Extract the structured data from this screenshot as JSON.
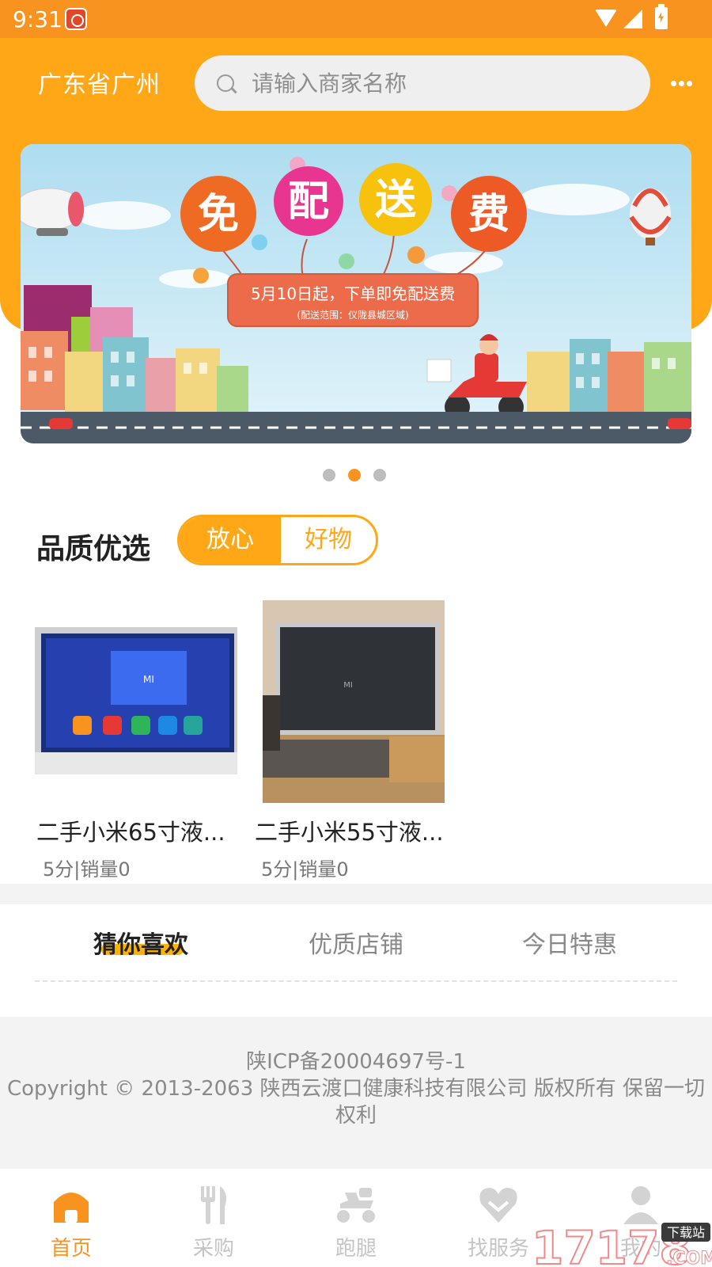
{
  "status_bar": {
    "time": "9:31"
  },
  "header": {
    "location": "广东省广州",
    "search_placeholder": "请输入商家名称"
  },
  "banner": {
    "balloon_chars": [
      "免",
      "配",
      "送",
      "费"
    ],
    "promo_main": "5月10日起，下单即免配送费",
    "promo_sub": "(配送范围：仪陇县城区域)",
    "active_dot": 1,
    "dot_count": 3
  },
  "quality": {
    "title": "品质优选",
    "toggle_left": "放心",
    "toggle_right": "好物",
    "products": [
      {
        "name": "二手小米65寸液...",
        "meta": "5分|销量0"
      },
      {
        "name": "二手小米55寸液...",
        "meta": "5分|销量0"
      }
    ]
  },
  "tabs": [
    {
      "label": "猜你喜欢",
      "active": true
    },
    {
      "label": "优质店铺",
      "active": false
    },
    {
      "label": "今日特惠",
      "active": false
    }
  ],
  "footer": {
    "icp": "陕ICP备20004697号-1",
    "copyright": "Copyright © 2013-2063 陕西云渡口健康科技有限公司 版权所有 保留一切权利"
  },
  "bottom_nav": [
    {
      "label": "首页",
      "icon": "home-icon",
      "active": true
    },
    {
      "label": "采购",
      "icon": "fork-knife-icon",
      "active": false
    },
    {
      "label": "跑腿",
      "icon": "scooter-icon",
      "active": false
    },
    {
      "label": "找服务",
      "icon": "heart-icon",
      "active": false
    },
    {
      "label": "我的",
      "icon": "user-icon",
      "active": false
    }
  ],
  "colors": {
    "brand_orange": "#F7931E",
    "header_yellow": "#FFA716",
    "tab_highlight": "#FFB300"
  },
  "watermark": {
    "number": "17178",
    "tag": "下载站",
    "suffix": ".COM"
  }
}
